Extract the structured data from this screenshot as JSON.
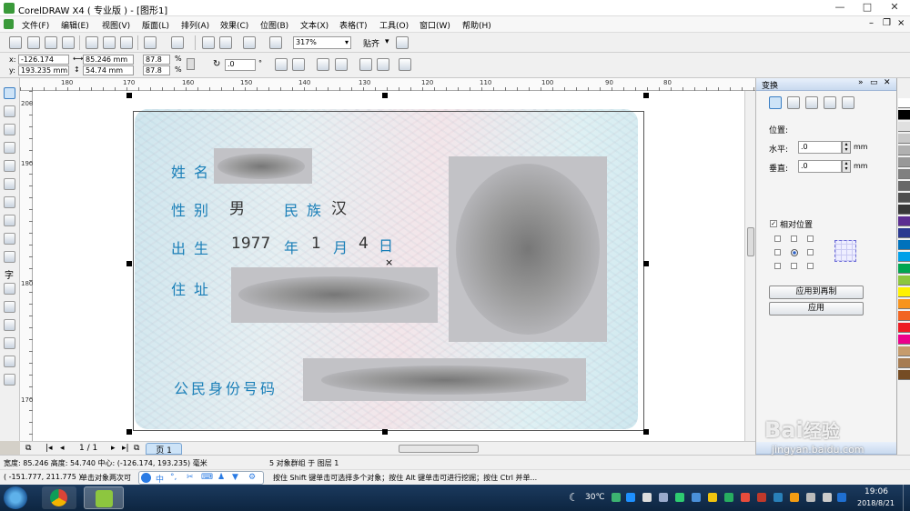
{
  "window": {
    "title": "CorelDRAW X4 ( 专业版 ) - [图形1]",
    "controls": [
      "—",
      "□",
      "✕"
    ]
  },
  "menu": [
    "文件(F)",
    "编辑(E)",
    "视图(V)",
    "版面(L)",
    "排列(A)",
    "效果(C)",
    "位图(B)",
    "文本(X)",
    "表格(T)",
    "工具(O)",
    "窗口(W)",
    "帮助(H)"
  ],
  "toolbar": {
    "zoom": "317%",
    "snap_label": "贴齐"
  },
  "propbar": {
    "x_label": "x:",
    "x_value": "-126.174 mm",
    "y_label": "y:",
    "y_value": "193.235 mm",
    "w_value": "85.246 mm",
    "h_value": "54.74 mm",
    "scale_x": "87.8",
    "scale_y": "87.8",
    "pct": "%",
    "rotation": ".0",
    "deg": "°"
  },
  "ruler": {
    "h_ticks": [
      "180",
      "170",
      "160",
      "150",
      "140",
      "130",
      "120",
      "110",
      "100",
      "90",
      "80"
    ],
    "v_ticks": [
      "200",
      "190",
      "180",
      "170"
    ]
  },
  "card": {
    "name_label": "姓名",
    "gender_label": "性别",
    "gender_value": "男",
    "ethnic_label": "民族",
    "ethnic_value": "汉",
    "birth_label": "出生",
    "birth_year": "1977",
    "year_char": "年",
    "birth_month": "1",
    "month_char": "月",
    "birth_day": "4",
    "day_char": "日",
    "address_label": "住址",
    "id_label": "公民身份号码"
  },
  "pagebar": {
    "page_count": "1 / 1",
    "page_tab": "页 1"
  },
  "status": {
    "line1_left": "宽度: 85.246 高度: 54.740 中心: (-126.174, 193.235) 毫米",
    "line1_right": "5 对象群组 于 图层 1",
    "line2_coords": "( -151.777, 211.775 )",
    "line2_hint_left": "单击对象两次可",
    "line2_hint_right": "按住 Shift 键单击可选择多个对象；按住 Alt 键单击可进行挖掘；按住 Ctrl 并单..."
  },
  "docker": {
    "title": "变换",
    "position_label": "位置:",
    "horizontal_label": "水平:",
    "horizontal_value": ".0",
    "vertical_label": "垂直:",
    "vertical_value": ".0",
    "unit": "mm",
    "relative_label": "相对位置",
    "apply_copy_label": "应用到再制",
    "apply_label": "应用"
  },
  "palette_colors": [
    "#ffffff",
    "#000000",
    "#e0e0e0",
    "#c8c8c8",
    "#b0b0b0",
    "#989898",
    "#808080",
    "#686868",
    "#505050",
    "#383838",
    "#5c2d91",
    "#2b3990",
    "#0072bc",
    "#00a0e9",
    "#00a651",
    "#8dc63f",
    "#fff200",
    "#f7941d",
    "#f26522",
    "#ed1c24",
    "#ec008c",
    "#c69c6d",
    "#a67c52",
    "#754c24"
  ],
  "taskbar": {
    "temp": "30℃",
    "time": "19:06",
    "date": "2018/8/21"
  },
  "ime": {
    "mode": "中"
  },
  "watermark": {
    "brand": "Bai",
    "brand_suffix": "经验",
    "url": "jingyan.baidu.com"
  }
}
